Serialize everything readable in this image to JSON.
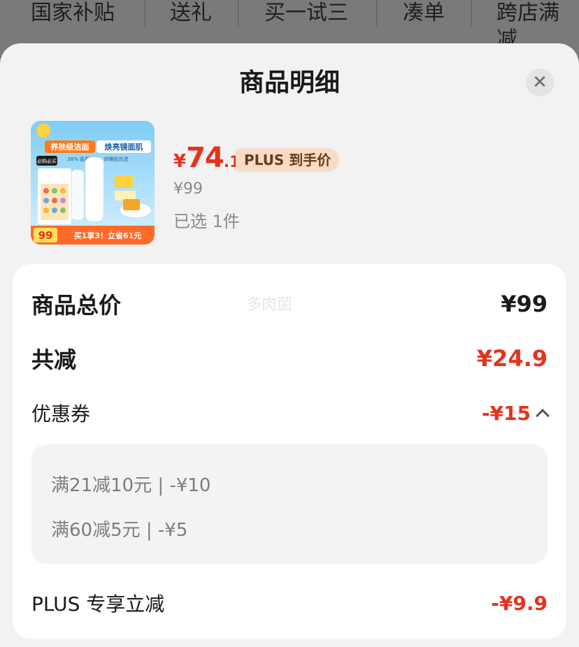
{
  "top_tabs": [
    "国家补贴",
    "送礼",
    "买一试三",
    "凑单",
    "跨店满减"
  ],
  "sheet": {
    "title": "商品明细",
    "close_icon": "close-icon"
  },
  "product": {
    "price_symbol": "¥",
    "price_int": "74",
    "price_dec": ".1",
    "plus_tag": "PLUS 到手价",
    "original_price": "¥99",
    "selected_count": "已选 1件",
    "image_texts": {
      "headline_left": "养肤级洁面",
      "headline_right": "焕亮镜面肌",
      "sub": "38% 氨基酸系 · 娇嫩肌优选",
      "badge": "必购必买",
      "price_badge": "99",
      "banner": "买1享3！立省61元"
    }
  },
  "breakdown": {
    "total_label": "商品总价",
    "total_value": "¥99",
    "watermark": "多肉菌",
    "reduce_label": "共减",
    "reduce_value": "¥24.9",
    "coupon_label": "优惠券",
    "coupon_value": "-¥15",
    "coupons": [
      "满21减10元 | -¥10",
      "满60减5元 | -¥5"
    ],
    "plus_label": "PLUS 专享立减",
    "plus_value": "-¥9.9"
  },
  "colors": {
    "accent_red": "#e5321d",
    "plus_tag_bg": "#f6dcc6"
  }
}
